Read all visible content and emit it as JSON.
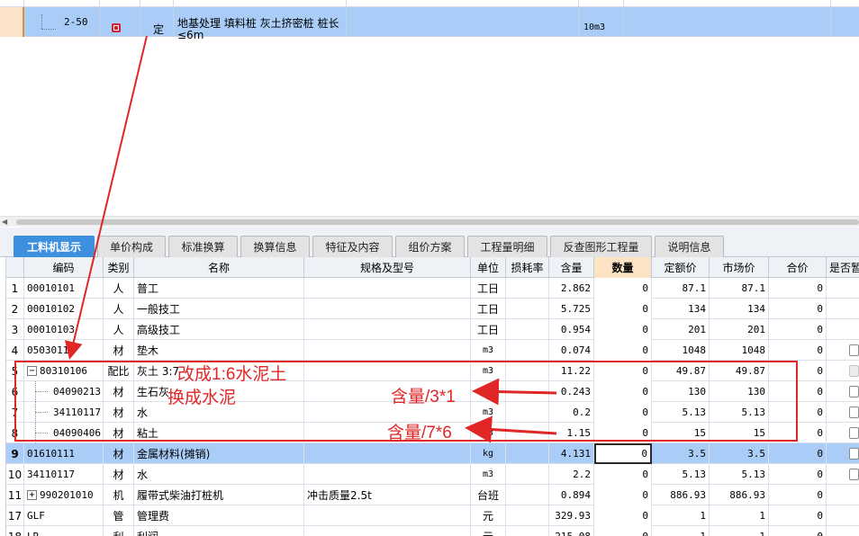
{
  "top_grid": {
    "row": {
      "code": "2-50",
      "type": "定",
      "name": "地基处理 填料桩 灰土挤密桩 桩长≤6m",
      "unit": "10m3"
    }
  },
  "tabs": [
    {
      "label": "工料机显示",
      "active": true
    },
    {
      "label": "单价构成"
    },
    {
      "label": "标准换算"
    },
    {
      "label": "换算信息"
    },
    {
      "label": "特征及内容"
    },
    {
      "label": "组价方案"
    },
    {
      "label": "工程量明细"
    },
    {
      "label": "反查图形工程量"
    },
    {
      "label": "说明信息"
    }
  ],
  "table": {
    "headers": {
      "code": "编码",
      "type": "类别",
      "name": "名称",
      "spec": "规格及型号",
      "unit": "单位",
      "loss": "损耗率",
      "content": "含量",
      "qty": "数量",
      "quota_price": "定额价",
      "market_price": "市场价",
      "total": "合价",
      "temp": "是否暂"
    },
    "rows": [
      {
        "no": "1",
        "code": "00010101",
        "type": "人",
        "name": "普工",
        "spec": "",
        "unit": "工日",
        "content": "2.862",
        "qty": "0",
        "quota": "87.1",
        "market": "87.1",
        "total": "0",
        "check": "none"
      },
      {
        "no": "2",
        "code": "00010102",
        "type": "人",
        "name": "一般技工",
        "spec": "",
        "unit": "工日",
        "content": "5.725",
        "qty": "0",
        "quota": "134",
        "market": "134",
        "total": "0",
        "check": "none"
      },
      {
        "no": "3",
        "code": "00010103",
        "type": "人",
        "name": "高级技工",
        "spec": "",
        "unit": "工日",
        "content": "0.954",
        "qty": "0",
        "quota": "201",
        "market": "201",
        "total": "0",
        "check": "none"
      },
      {
        "no": "4",
        "code": "0503011",
        "type": "材",
        "name": "垫木",
        "spec": "",
        "unit": "m3",
        "content": "0.074",
        "qty": "0",
        "quota": "1048",
        "market": "1048",
        "total": "0",
        "check": "box"
      },
      {
        "no": "5",
        "code": "80310106",
        "type": "配比",
        "name": "灰土 3:7",
        "spec": "",
        "unit": "m3",
        "content": "11.22",
        "qty": "0",
        "quota": "49.87",
        "market": "49.87",
        "total": "0",
        "check": "disabled",
        "expander": "−"
      },
      {
        "no": "6",
        "code": "04090213",
        "type": "材",
        "name": "生石灰",
        "spec": "",
        "unit": "",
        "content": "0.243",
        "qty": "0",
        "quota": "130",
        "market": "130",
        "total": "0",
        "check": "box",
        "child": true
      },
      {
        "no": "7",
        "code": "34110117",
        "type": "材",
        "name": "水",
        "spec": "",
        "unit": "m3",
        "content": "0.2",
        "qty": "0",
        "quota": "5.13",
        "market": "5.13",
        "total": "0",
        "check": "box",
        "child": true
      },
      {
        "no": "8",
        "code": "04090406",
        "type": "材",
        "name": "粘土",
        "spec": "",
        "unit": "m3",
        "content": "1.15",
        "qty": "0",
        "quota": "15",
        "market": "15",
        "total": "0",
        "check": "box",
        "child": true
      },
      {
        "no": "9",
        "code": "01610111",
        "type": "材",
        "name": "金属材料(摊销)",
        "spec": "",
        "unit": "kg",
        "content": "4.131",
        "qty": "0",
        "quota": "3.5",
        "market": "3.5",
        "total": "0",
        "check": "box",
        "selected": true
      },
      {
        "no": "10",
        "code": "34110117",
        "type": "材",
        "name": "水",
        "spec": "",
        "unit": "m3",
        "content": "2.2",
        "qty": "0",
        "quota": "5.13",
        "market": "5.13",
        "total": "0",
        "check": "box"
      },
      {
        "no": "11",
        "code": "990201010",
        "type": "机",
        "name": "履带式柴油打桩机",
        "spec": "冲击质量2.5t",
        "unit": "台班",
        "content": "0.894",
        "qty": "0",
        "quota": "886.93",
        "market": "886.93",
        "total": "0",
        "check": "none",
        "expander": "+"
      },
      {
        "no": "17",
        "code": "GLF",
        "type": "管",
        "name": "管理费",
        "spec": "",
        "unit": "元",
        "content": "329.93",
        "qty": "0",
        "quota": "1",
        "market": "1",
        "total": "0",
        "check": "none"
      },
      {
        "no": "18",
        "code": "LR",
        "type": "利",
        "name": "利润",
        "spec": "",
        "unit": "元",
        "content": "215.08",
        "qty": "0",
        "quota": "1",
        "market": "1",
        "total": "0",
        "check": "none"
      }
    ]
  },
  "annotations": {
    "change_mix": "改成1:6水泥土",
    "change_cement": "换成水泥",
    "content_div3": "含量/3*1",
    "content_div7": "含量/7*6",
    "color": "#e02626"
  }
}
